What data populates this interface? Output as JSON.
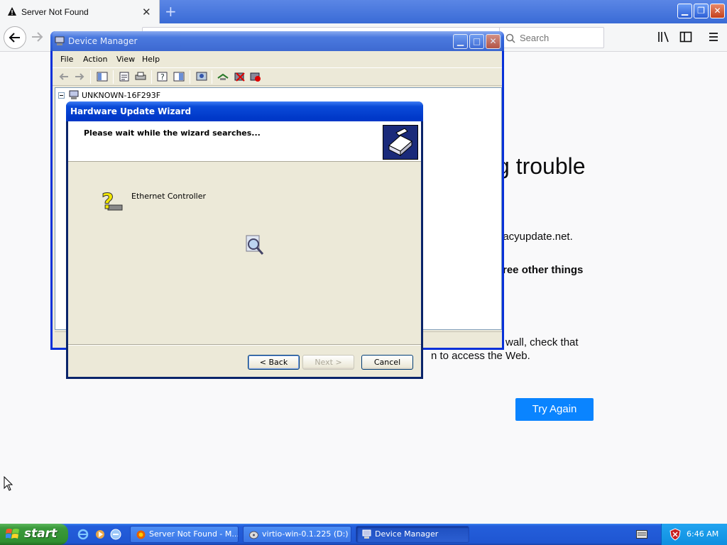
{
  "browser": {
    "tab_title": "Server Not Found",
    "search_placeholder": "Search"
  },
  "content": {
    "title_fragment": "g trouble",
    "line1_fragment": "gacyupdate.net.",
    "line2_fragment": "ree other things",
    "line3_fragment": "wall, check that",
    "line4_fragment": "n to access the Web.",
    "try_again_label": "Try Again",
    "try_again_color": "#0a84ff"
  },
  "device_manager": {
    "title": "Device Manager",
    "menu": [
      "File",
      "Action",
      "View",
      "Help"
    ],
    "tree_root": "UNKNOWN-16F293F"
  },
  "wizard": {
    "title": "Hardware Update Wizard",
    "heading": "Please wait while the wizard searches...",
    "device_name": "Ethernet Controller",
    "back_label": "< Back",
    "next_label": "Next >",
    "cancel_label": "Cancel"
  },
  "taskbar": {
    "start_label": "start",
    "tasks": [
      {
        "label": "Server Not Found - M..."
      },
      {
        "label": "virtio-win-0.1.225 (D:)"
      },
      {
        "label": "Device Manager"
      }
    ],
    "clock": "6:46 AM"
  }
}
